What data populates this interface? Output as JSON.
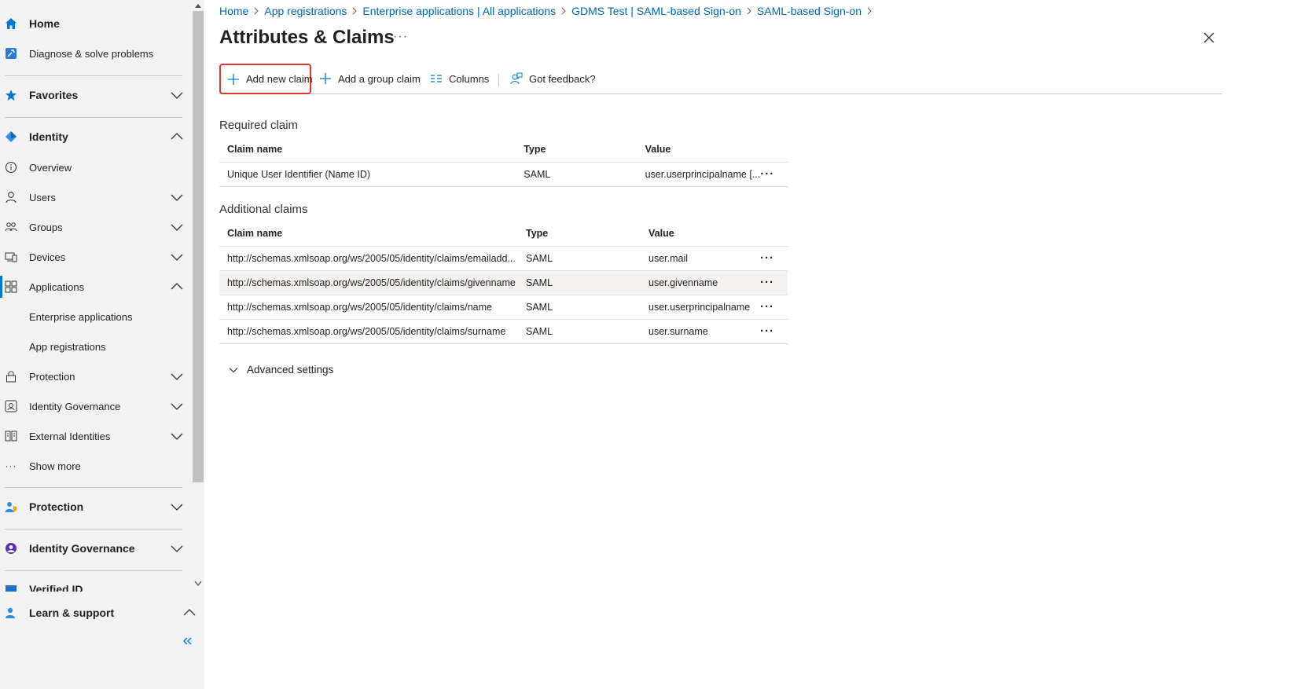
{
  "sidebar": {
    "home": "Home",
    "diagnose": "Diagnose & solve problems",
    "favorites": "Favorites",
    "identity": "Identity",
    "overview": "Overview",
    "users": "Users",
    "groups": "Groups",
    "devices": "Devices",
    "applications": "Applications",
    "enterprise_apps": "Enterprise applications",
    "app_registrations": "App registrations",
    "protection_sub": "Protection",
    "identity_governance_sub": "Identity Governance",
    "external_identities": "External Identities",
    "show_more": "Show more",
    "protection": "Protection",
    "identity_governance": "Identity Governance",
    "verified_id": "Verified ID",
    "learn_support": "Learn & support"
  },
  "breadcrumb": [
    "Home",
    "App registrations",
    "Enterprise applications | All applications",
    "GDMS Test | SAML-based Sign-on",
    "SAML-based Sign-on"
  ],
  "page": {
    "title": "Attributes & Claims",
    "more": "···"
  },
  "toolbar": {
    "add_new_claim": "Add new claim",
    "add_group_claim": "Add a group claim",
    "columns": "Columns",
    "feedback": "Got feedback?"
  },
  "required": {
    "title": "Required claim",
    "headers": [
      "Claim name",
      "Type",
      "Value"
    ],
    "rows": [
      {
        "name": "Unique User Identifier (Name ID)",
        "type": "SAML",
        "value": "user.userprincipalname [..."
      }
    ]
  },
  "additional": {
    "title": "Additional claims",
    "headers": [
      "Claim name",
      "Type",
      "Value"
    ],
    "rows": [
      {
        "name": "http://schemas.xmlsoap.org/ws/2005/05/identity/claims/emailadd...",
        "type": "SAML",
        "value": "user.mail"
      },
      {
        "name": "http://schemas.xmlsoap.org/ws/2005/05/identity/claims/givenname",
        "type": "SAML",
        "value": "user.givenname"
      },
      {
        "name": "http://schemas.xmlsoap.org/ws/2005/05/identity/claims/name",
        "type": "SAML",
        "value": "user.userprincipalname"
      },
      {
        "name": "http://schemas.xmlsoap.org/ws/2005/05/identity/claims/surname",
        "type": "SAML",
        "value": "user.surname"
      }
    ]
  },
  "row_more": "···",
  "advanced": "Advanced settings",
  "colors": {
    "accent": "#0078d4",
    "link": "#0066b8",
    "highlight_border": "#e0362c"
  },
  "icons": {
    "home": "home-icon",
    "diagnose": "wrench-icon",
    "favorites": "star-icon",
    "identity": "diamond-icon",
    "overview": "info-icon",
    "users": "person-icon",
    "groups": "people-icon",
    "devices": "devices-icon",
    "applications": "apps-icon",
    "protection": "lock-icon",
    "governance": "badge-icon",
    "external": "external-icon",
    "show_more": "ellipsis-icon",
    "close": "close-icon",
    "add": "plus-icon",
    "columns": "columns-icon",
    "feedback": "feedback-icon"
  }
}
